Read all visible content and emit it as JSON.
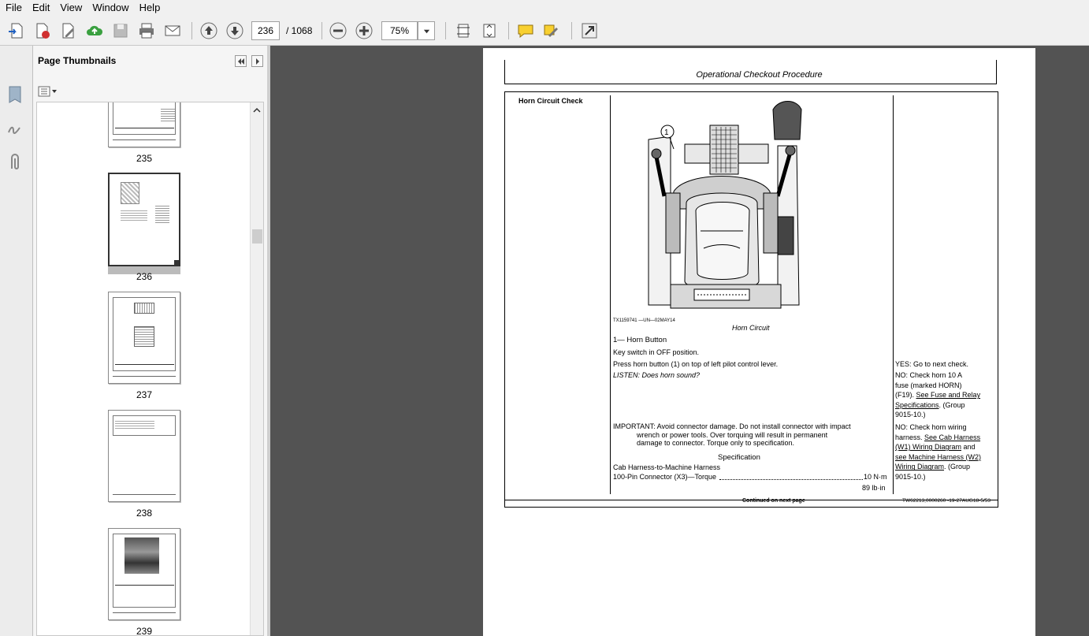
{
  "menu": [
    "File",
    "Edit",
    "View",
    "Window",
    "Help"
  ],
  "toolbar": {
    "page_current": "236",
    "page_total": "/ 1068",
    "zoom": "75%"
  },
  "sidebar": {
    "title": "Page Thumbnails",
    "thumbnails": [
      {
        "label": "235"
      },
      {
        "label": "236"
      },
      {
        "label": "237"
      },
      {
        "label": "238"
      },
      {
        "label": "239"
      }
    ]
  },
  "doc": {
    "header": "Operational Checkout Procedure",
    "section_title": "Horn Circuit Check",
    "figure_id": "TX1159741 —UN—02MAY14",
    "figure_caption": "Horn Circuit",
    "callout_number": "1",
    "callout_legend": "1— Horn Button",
    "steps": [
      "Key switch in OFF position.",
      "Press horn button (1) on top of left pilot control lever.",
      "LISTEN:  Does horn sound?"
    ],
    "important": [
      "IMPORTANT: Avoid connector damage. Do not install connector with impact",
      "wrench or power tools.  Over torquing will result in permanent",
      "damage to connector.  Torque only to specification."
    ],
    "spec_heading": "Specification",
    "spec_line1": "Cab Harness-to-Machine Harness",
    "spec_line2": "100-Pin Connector (X3)—Torque",
    "spec_value1": "10 N·m",
    "spec_value2": "89 lb·in",
    "yes_text": "YES:  Go to next check.",
    "no1": [
      "NO:  Check horn 10 A",
      "fuse (marked HORN)",
      "(F19). ",
      "See Fuse and Relay",
      "Specifications",
      ". (Group",
      "9015-10.)"
    ],
    "no2": [
      "NO:  Check horn wiring",
      "harness. ",
      "See Cab Harness",
      "(W1) Wiring Diagram",
      " and",
      "see Machine Harness (W2)",
      "Wiring Diagram",
      ". (Group",
      "9015-10.)"
    ],
    "footer_continued": "Continued on next page",
    "footer_ref": "TW62213,0000260 -19-27AUG18-5/53"
  }
}
